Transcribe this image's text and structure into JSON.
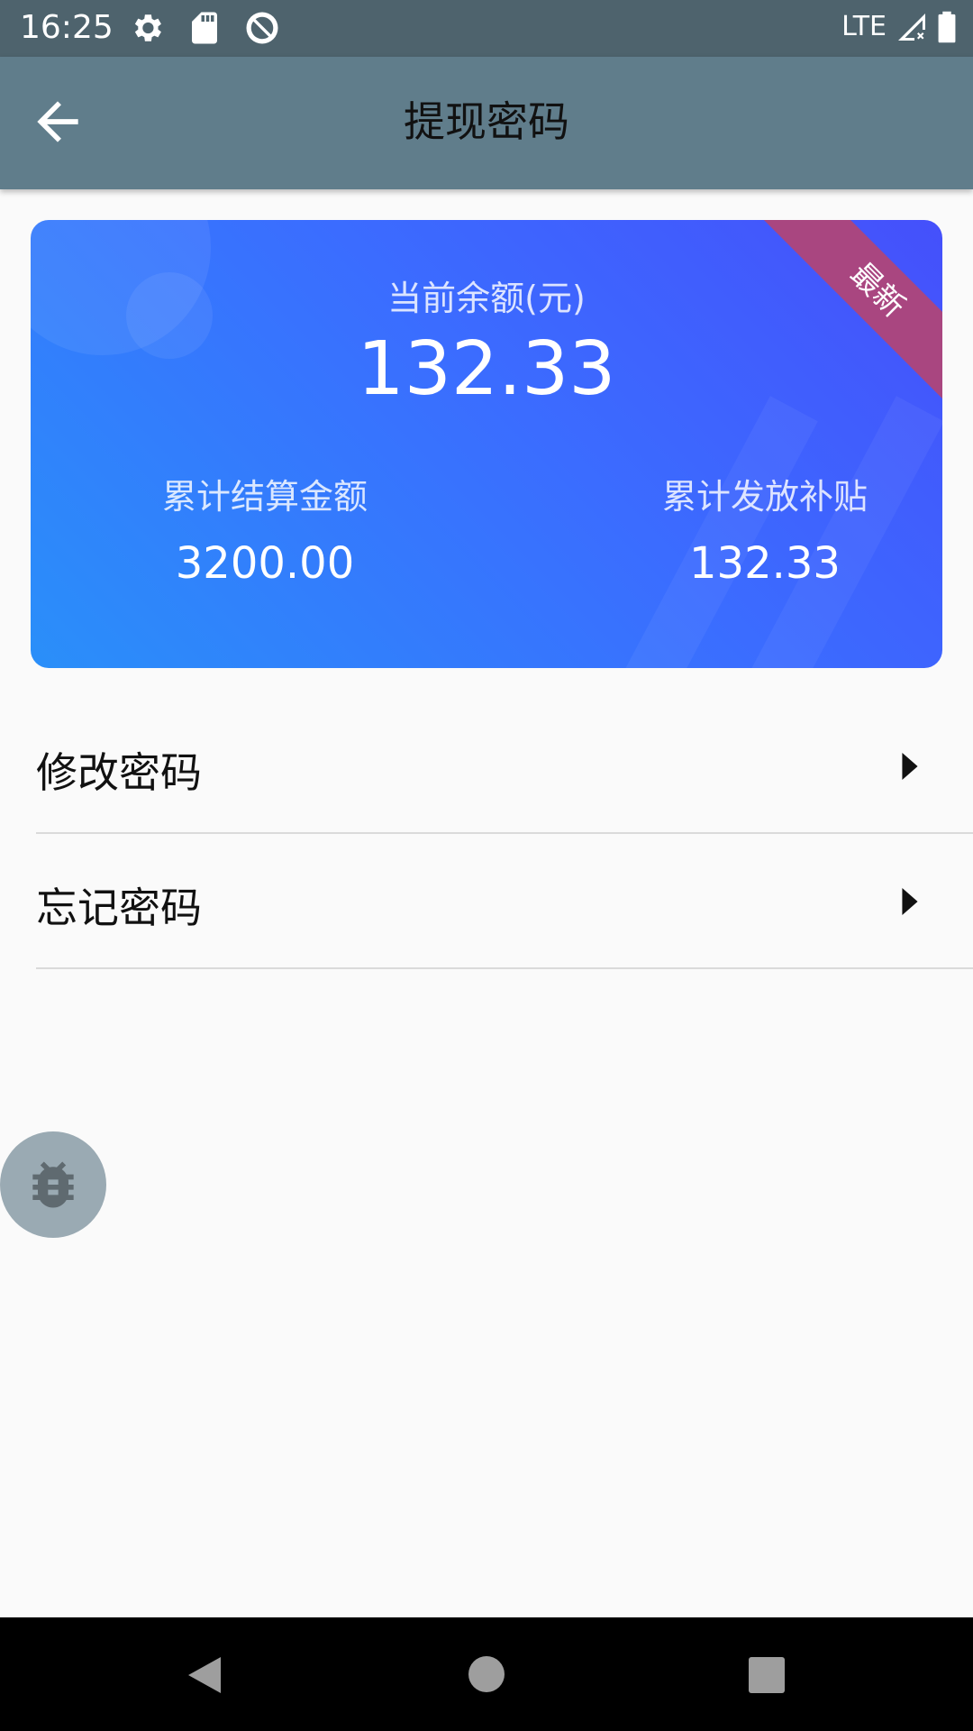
{
  "status_bar": {
    "time": "16:25",
    "network": "LTE",
    "icons": [
      "settings-icon",
      "sd-card-icon",
      "at-sign-icon",
      "signal-icon",
      "battery-icon"
    ]
  },
  "app_bar": {
    "title": "提现密码",
    "back_icon": "arrow-back-icon"
  },
  "balance_card": {
    "ribbon": "最新",
    "balance_label": "当前余额(元)",
    "balance_value": "132.33",
    "stats": [
      {
        "label": "累计结算金额",
        "value": "3200.00"
      },
      {
        "label": "累计发放补贴",
        "value": "132.33"
      }
    ],
    "colors": {
      "gradient_start": "#2a8ff9",
      "gradient_end": "#4550fb",
      "ribbon": "#a94680"
    }
  },
  "menu": {
    "items": [
      {
        "label": "修改密码",
        "icon": "caret-right-icon"
      },
      {
        "label": "忘记密码",
        "icon": "caret-right-icon"
      }
    ]
  },
  "debug_fab": {
    "icon": "bug-icon"
  },
  "nav_bar": {
    "buttons": [
      "back",
      "home",
      "recents"
    ]
  },
  "colors": {
    "status_bar": "#4e636d",
    "app_bar": "#607d8b",
    "background": "#fafafa"
  }
}
